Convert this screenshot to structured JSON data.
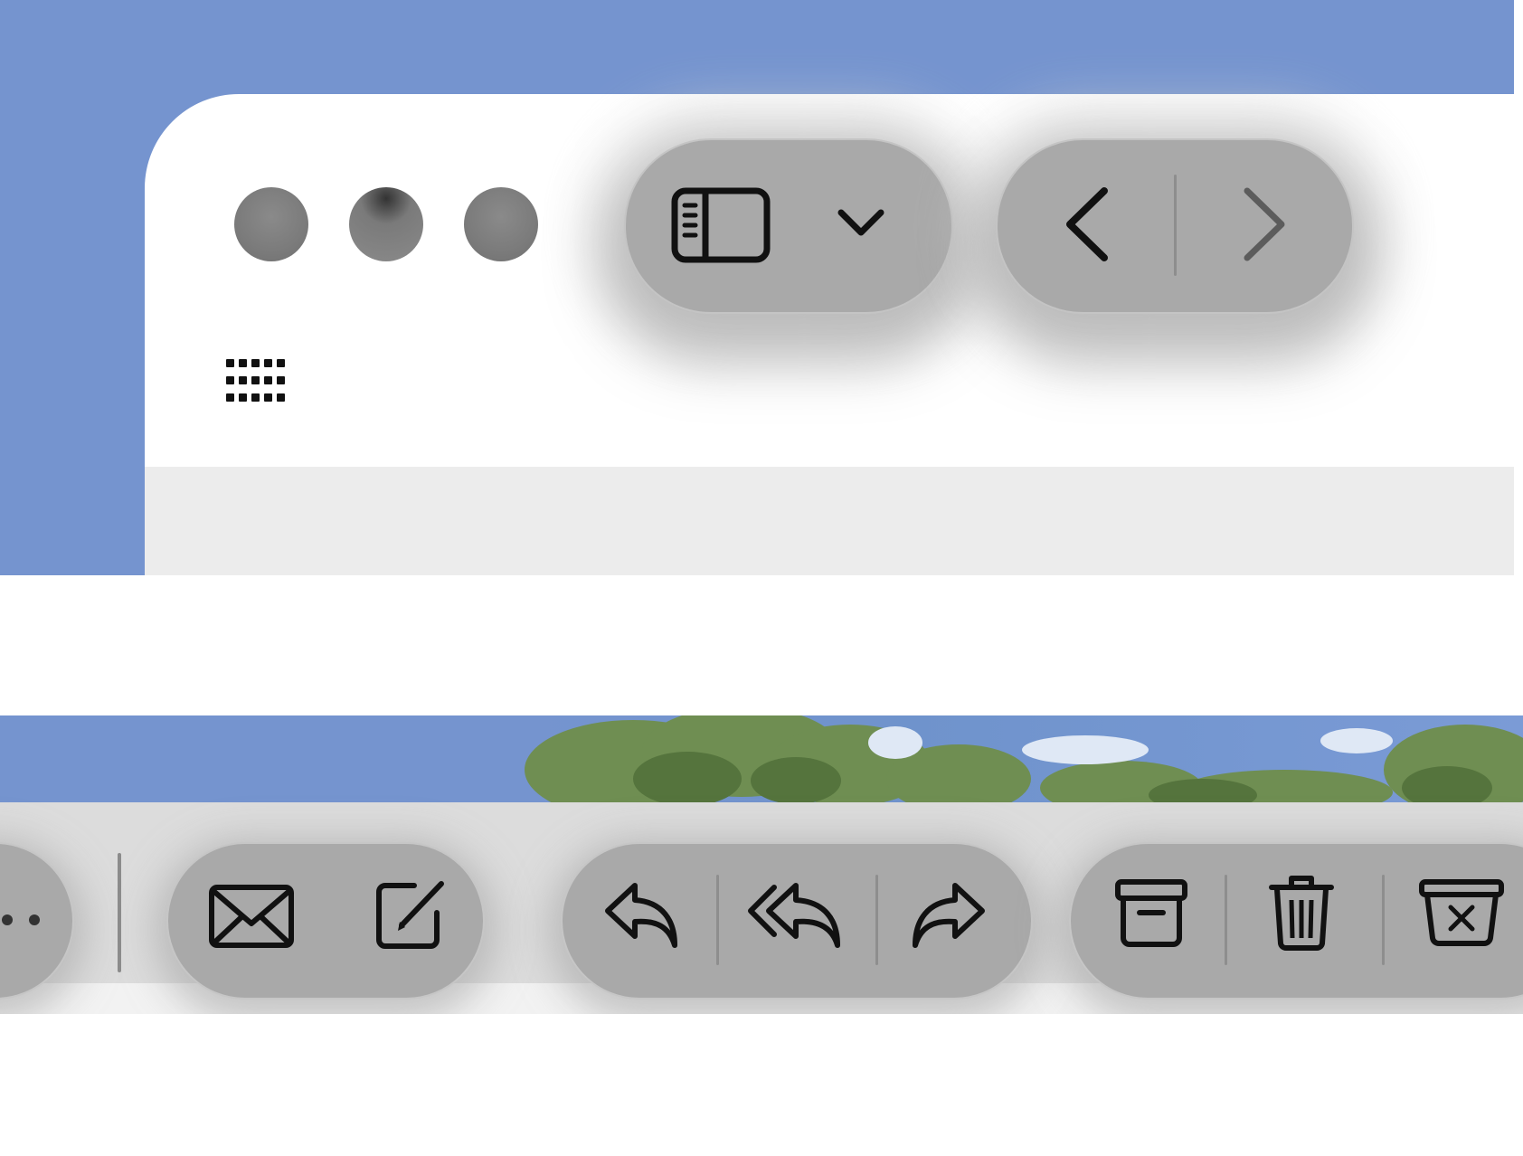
{
  "window": {
    "traffic_lights": [
      "close",
      "minimize",
      "zoom"
    ],
    "colors": {
      "desktop_blue": "#7594cf",
      "window_bg": "#ffffff",
      "pill_bg": "#a9a9a9",
      "icon_color": "#111111",
      "disabled_icon": "#5c5c5c"
    }
  },
  "top_toolbar": {
    "icons": [
      "app-grid-icon",
      "sidebar-icon",
      "chevron-down-icon",
      "back-icon",
      "forward-icon"
    ]
  },
  "bottom_toolbar": {
    "icons": [
      "more-icon",
      "envelope-icon",
      "compose-icon",
      "reply-icon",
      "reply-all-icon",
      "forward-icon",
      "archive-icon",
      "trash-icon",
      "junk-icon"
    ]
  }
}
